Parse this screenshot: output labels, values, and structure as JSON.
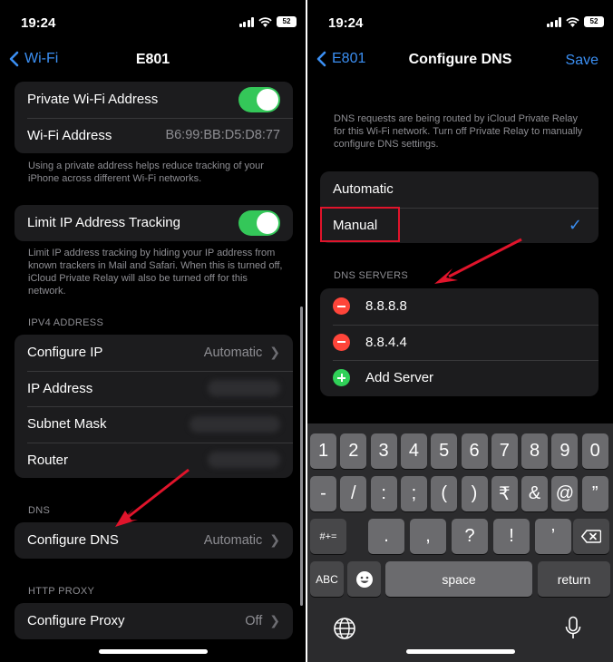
{
  "left": {
    "status": {
      "time": "19:24",
      "battery": "52"
    },
    "nav": {
      "back_label": "Wi-Fi",
      "title": "E801"
    },
    "private_wifi": {
      "label": "Private Wi-Fi Address",
      "enabled": true
    },
    "wifi_address": {
      "label": "Wi-Fi Address",
      "value": "B6:99:BB:D5:D8:77"
    },
    "private_footer": "Using a private address helps reduce tracking of your iPhone across different Wi-Fi networks.",
    "limit_tracking": {
      "label": "Limit IP Address Tracking",
      "enabled": true
    },
    "limit_footer": "Limit IP address tracking by hiding your IP address from known trackers in Mail and Safari. When this is turned off, iCloud Private Relay will also be turned off for this network.",
    "ipv4": {
      "header": "IPV4 ADDRESS",
      "configure_ip": {
        "label": "Configure IP",
        "value": "Automatic"
      },
      "ip_address": {
        "label": "IP Address"
      },
      "subnet_mask": {
        "label": "Subnet Mask"
      },
      "router": {
        "label": "Router"
      }
    },
    "dns": {
      "header": "DNS",
      "label": "Configure DNS",
      "value": "Automatic"
    },
    "proxy": {
      "header": "HTTP PROXY",
      "label": "Configure Proxy",
      "value": "Off"
    }
  },
  "right": {
    "status": {
      "time": "19:24",
      "battery": "52"
    },
    "nav": {
      "back_label": "E801",
      "title": "Configure DNS",
      "save_label": "Save"
    },
    "info": "DNS requests are being routed by iCloud Private Relay for this Wi-Fi network. Turn off Private Relay to manually configure DNS settings.",
    "modes": {
      "automatic": "Automatic",
      "manual": "Manual",
      "selected": "Manual"
    },
    "servers": {
      "header": "DNS SERVERS",
      "items": [
        "8.8.8.8",
        "8.8.4.4"
      ],
      "add_label": "Add Server"
    },
    "keyboard": {
      "row1": [
        "1",
        "2",
        "3",
        "4",
        "5",
        "6",
        "7",
        "8",
        "9",
        "0"
      ],
      "row2": [
        "-",
        "/",
        ":",
        ";",
        "(",
        ")",
        "₹",
        "&",
        "@",
        "”"
      ],
      "row3_left": "#+=",
      "row3": [
        ".",
        ",",
        "?",
        "!",
        "’"
      ],
      "abc": "ABC",
      "space": "space",
      "return": "return"
    }
  },
  "colors": {
    "accent": "#3b8ff3",
    "toggle_on": "#34c759",
    "delete": "#ff453a",
    "add": "#30d158",
    "highlight": "#e0142b"
  }
}
